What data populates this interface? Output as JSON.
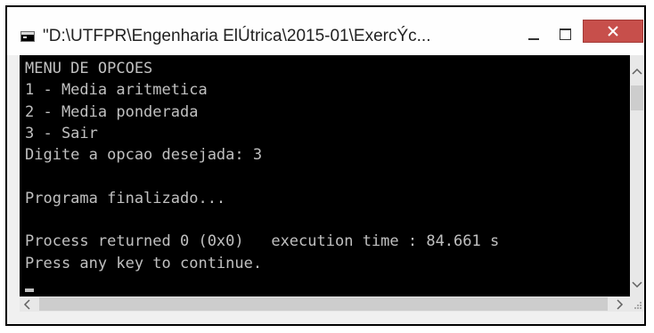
{
  "window": {
    "title": "\"D:\\UTFPR\\Engenharia ElÚtrica\\2015-01\\ExercÝc...",
    "app_icon": "console-window-icon",
    "controls": {
      "minimize_icon": "minimize-icon",
      "maximize_icon": "maximize-icon",
      "close_icon": "close-icon",
      "close_color": "#c74f4b"
    }
  },
  "console": {
    "background": "#000000",
    "foreground": "#c0c0c0",
    "lines": [
      "MENU DE OPCOES",
      "1 - Media aritmetica",
      "2 - Media ponderada",
      "3 - Sair",
      "Digite a opcao desejada: 3",
      "",
      "Programa finalizado...",
      "",
      "Process returned 0 (0x0)   execution time : 84.661 s",
      "Press any key to continue."
    ]
  },
  "scrollbars": {
    "vertical": {
      "up_icon": "chevron-up-icon",
      "down_icon": "chevron-down-icon"
    },
    "horizontal": {
      "left_icon": "chevron-left-icon",
      "right_icon": "chevron-right-icon"
    },
    "grip_icon": "resize-grip-icon"
  }
}
